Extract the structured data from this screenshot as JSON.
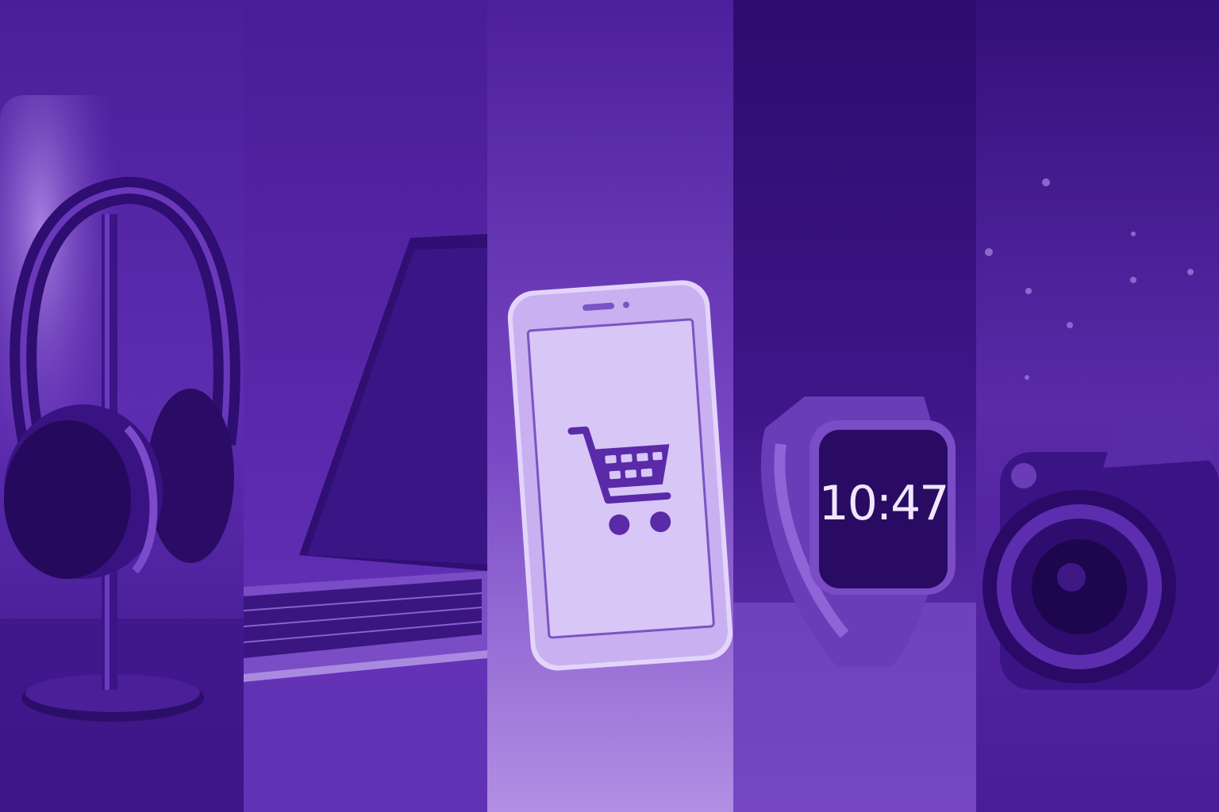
{
  "panels": [
    {
      "subject": "headphones",
      "icon": "headphones-icon"
    },
    {
      "subject": "laptop",
      "icon": "laptop-icon"
    },
    {
      "subject": "smartphone",
      "icon": "smartphone-icon",
      "screen_icon": "shopping-cart-icon"
    },
    {
      "subject": "smartwatch",
      "icon": "smartwatch-icon",
      "time": "10:47"
    },
    {
      "subject": "camera",
      "icon": "camera-icon"
    }
  ],
  "colors": {
    "dark_purple": "#2e0f72",
    "mid_purple": "#5a2aa8",
    "light_purple": "#b99be6",
    "screen_lilac": "#d2bff0"
  }
}
